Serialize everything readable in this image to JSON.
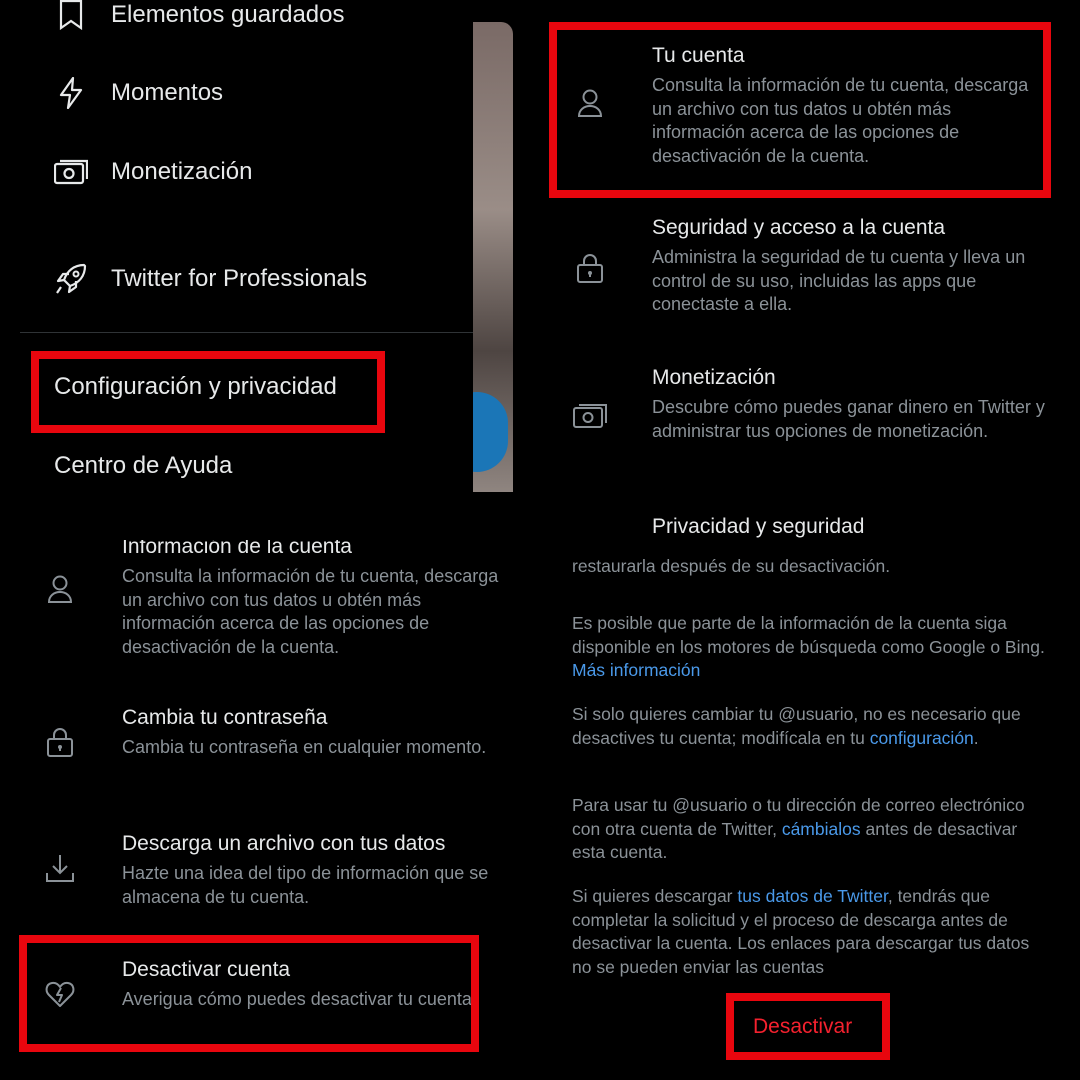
{
  "drawer": {
    "items": [
      {
        "label": "Elementos guardados",
        "icon": "bookmark-icon"
      },
      {
        "label": "Momentos",
        "icon": "lightning-icon"
      },
      {
        "label": "Monetización",
        "icon": "money-icon"
      },
      {
        "label": "Twitter for Professionals",
        "icon": "rocket-icon"
      }
    ],
    "settings_label": "Configuración y privacidad",
    "help_label": "Centro de Ayuda"
  },
  "settings": {
    "rows": [
      {
        "title": "Tu cuenta",
        "desc": "Consulta la información de tu cuenta, descarga un archivo con tus datos u obtén más información acerca de las opciones de desactivación de la cuenta.",
        "icon": "person-icon"
      },
      {
        "title": "Seguridad y acceso a la cuenta",
        "desc": "Administra la seguridad de tu cuenta y lleva un control de su uso, incluidas las apps que conectaste a ella.",
        "icon": "lock-icon"
      },
      {
        "title": "Monetización",
        "desc": "Descubre cómo puedes ganar dinero en Twitter y administrar tus opciones de monetización.",
        "icon": "money-icon"
      },
      {
        "title": "Privacidad y seguridad",
        "desc": "",
        "icon": ""
      }
    ]
  },
  "account": {
    "rows": [
      {
        "title": "Información de la cuenta",
        "desc": "Consulta la información de tu cuenta, descarga un archivo con tus datos u obtén más información acerca de las opciones de desactivación de la cuenta.",
        "icon": "person-icon"
      },
      {
        "title": "Cambia tu contraseña",
        "desc": "Cambia tu contraseña en cualquier momento.",
        "icon": "lock-icon"
      },
      {
        "title": "Descarga un archivo con tus datos",
        "desc": "Hazte una idea del tipo de información que se almacena de tu cuenta.",
        "icon": "download-icon"
      },
      {
        "title": "Desactivar cuenta",
        "desc": "Averigua cómo puedes desactivar tu cuenta.",
        "icon": "broken-heart-icon"
      }
    ]
  },
  "deactivate": {
    "p0": "restaurarla después de su desactivación.",
    "p1_text": "Es posible que parte de la información de la cuenta siga disponible en los motores de búsqueda como Google o Bing.",
    "p1_link": "Más información",
    "p2_text": "Si solo quieres cambiar tu @usuario, no es necesario que desactives tu cuenta; modifícala en tu",
    "p2_link": "configuración",
    "p2_end": ".",
    "p3_text": "Para usar tu @usuario o tu dirección de correo electrónico con otra cuenta de Twitter,",
    "p3_link": "cámbialos",
    "p3_end": "antes de desactivar esta cuenta.",
    "p4_text": "Si quieres descargar",
    "p4_link": "tus datos de Twitter",
    "p4_end": ", tendrás que completar la solicitud y el proceso de descarga antes de desactivar la cuenta. Los enlaces para descargar tus datos no se pueden enviar las cuentas",
    "button": "Desactivar"
  },
  "colors": {
    "highlight": "#e8060e",
    "link": "#4a99e9",
    "danger": "#f4212e"
  }
}
